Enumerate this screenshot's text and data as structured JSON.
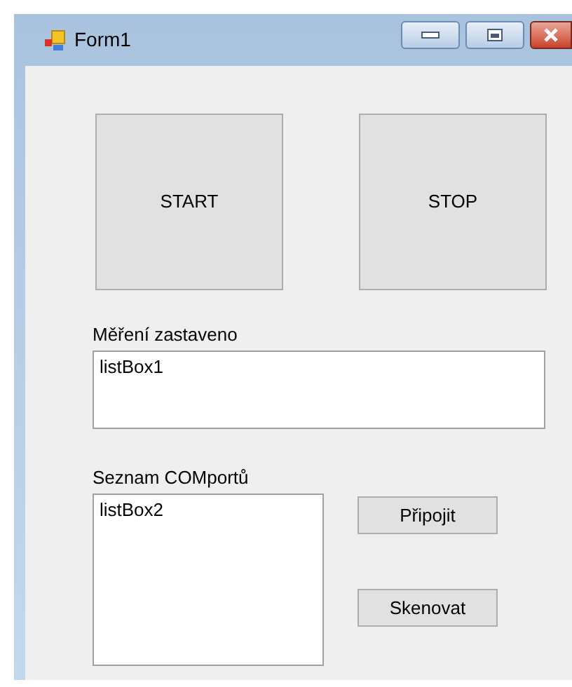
{
  "window": {
    "title": "Form1"
  },
  "buttons": [
    {
      "label": "START"
    },
    {
      "label": "STOP"
    }
  ],
  "status_label": "Měření zastaveno",
  "listbox1": {
    "items": [
      "listBox1"
    ]
  },
  "comports_label": "Seznam COMportů",
  "listbox2": {
    "items": [
      "listBox2"
    ]
  },
  "side_buttons": [
    {
      "label": "Připojit"
    },
    {
      "label": "Skenovat"
    }
  ]
}
